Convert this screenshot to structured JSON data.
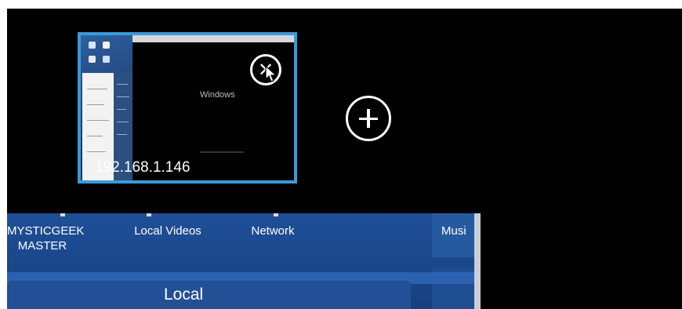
{
  "session": {
    "ip": "192.168.1.146",
    "remote_text": "Windows"
  },
  "panel": {
    "items": [
      {
        "label": "MYSTICGEEK\nMASTER"
      },
      {
        "label": "Local Videos"
      },
      {
        "label": "Network"
      },
      {
        "label": "Musi"
      }
    ],
    "section_title": "Local"
  },
  "colors": {
    "tile_border": "#3a9ad9",
    "panel_blue": "#1f4f97",
    "background": "#000000"
  },
  "icons": {
    "close": "close-circle-icon",
    "add": "plus-circle-icon",
    "cursor": "mouse-pointer-icon"
  }
}
